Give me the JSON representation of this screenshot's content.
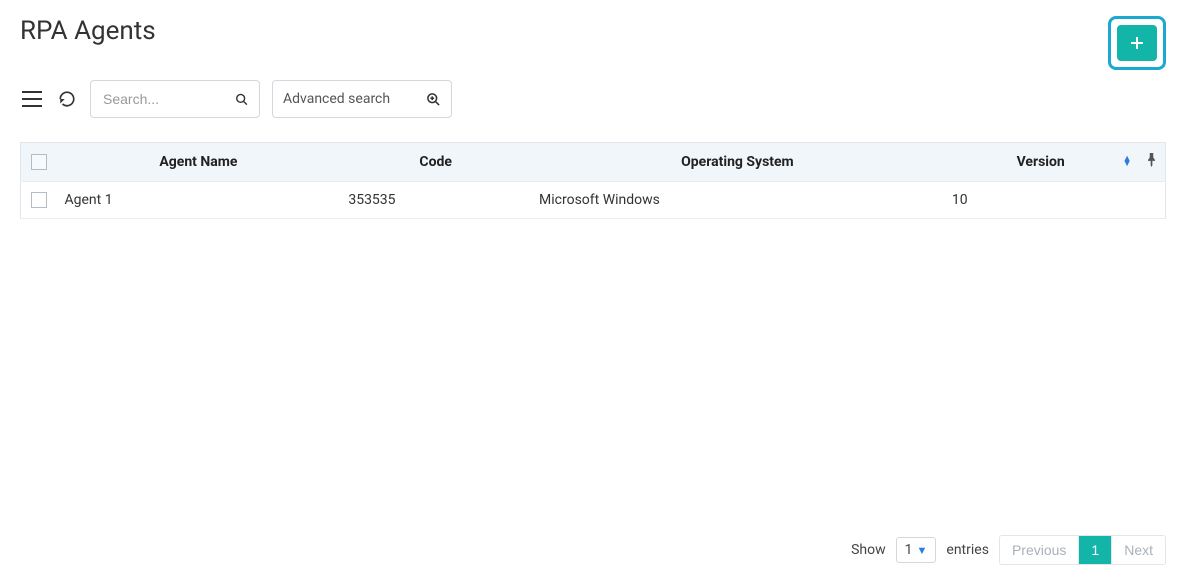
{
  "page": {
    "title": "RPA Agents"
  },
  "toolbar": {
    "search_placeholder": "Search...",
    "advanced_label": "Advanced search"
  },
  "table": {
    "headers": {
      "name": "Agent Name",
      "code": "Code",
      "os": "Operating System",
      "version": "Version"
    },
    "rows": [
      {
        "name": "Agent 1",
        "code": "353535",
        "os": "Microsoft Windows",
        "version": "10"
      }
    ]
  },
  "footer": {
    "show_label": "Show",
    "entries_label": "entries",
    "page_size": "1",
    "prev_label": "Previous",
    "next_label": "Next",
    "current_page": "1"
  }
}
